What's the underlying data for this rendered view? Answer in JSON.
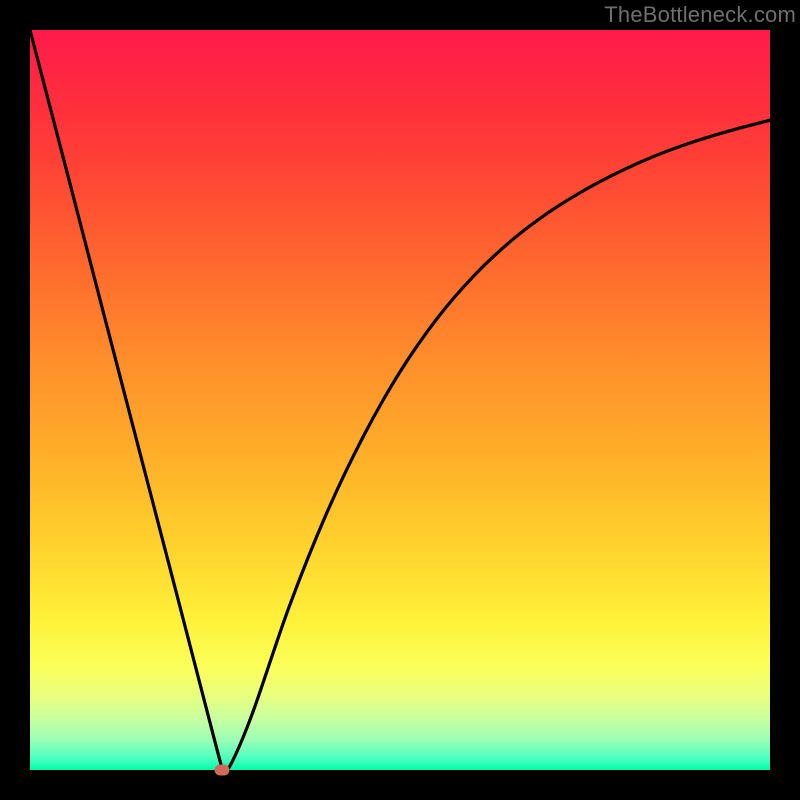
{
  "watermark": "TheBottleneck.com",
  "colors": {
    "page_bg": "#000000",
    "curve": "#000000",
    "marker": "#cf6a5c",
    "gradient_top": "#ff1a4b",
    "gradient_bottom": "#00ffa8"
  },
  "chart_data": {
    "type": "line",
    "title": "",
    "xlabel": "",
    "ylabel": "",
    "xlim": [
      0,
      100
    ],
    "ylim": [
      0,
      100
    ],
    "x": [
      0,
      5,
      10,
      15,
      20,
      25,
      26,
      27,
      30,
      35,
      40,
      45,
      50,
      55,
      60,
      65,
      70,
      75,
      80,
      85,
      90,
      95,
      100
    ],
    "values": [
      100,
      80.8,
      61.5,
      42.3,
      23.1,
      3.8,
      0,
      0.5,
      7.5,
      22.0,
      34.5,
      45.0,
      53.8,
      61.0,
      66.8,
      71.5,
      75.3,
      78.4,
      81.0,
      83.2,
      85.0,
      86.5,
      87.8
    ],
    "marker": {
      "x": 26,
      "y": 0
    },
    "annotations": []
  }
}
